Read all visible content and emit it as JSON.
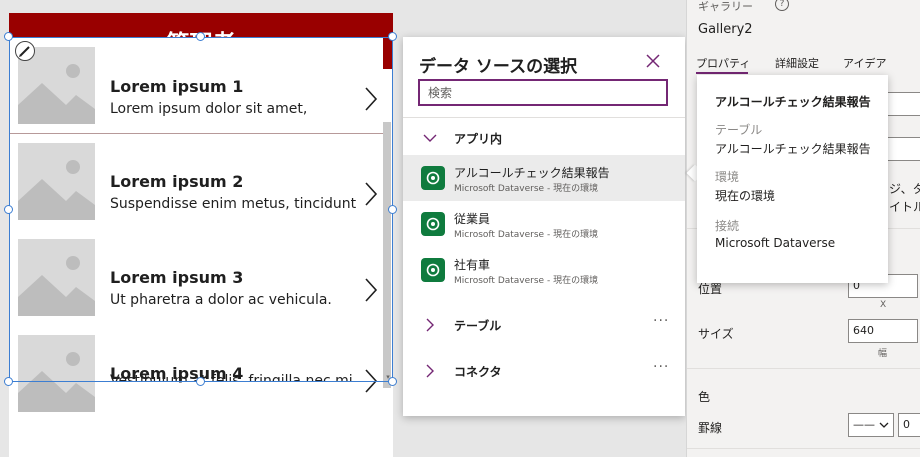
{
  "app": {
    "header_title": "管理者",
    "gallery_items": [
      {
        "title": "Lorem ipsum 1",
        "subtitle": "Lorem ipsum dolor sit amet,"
      },
      {
        "title": "Lorem ipsum 2",
        "subtitle": "Suspendisse enim metus, tincidunt"
      },
      {
        "title": "Lorem ipsum 3",
        "subtitle": "Ut pharetra a dolor ac vehicula."
      },
      {
        "title": "Lorem ipsum 4",
        "subtitle": "Vestibulum at felis, fringilla nec mi"
      }
    ],
    "header_color": "#990000"
  },
  "data_source_panel": {
    "title": "データ ソースの選択",
    "search_placeholder": "検索",
    "groups": {
      "in_app": "アプリ内",
      "tables": "テーブル",
      "connectors": "コネクタ",
      "more": "···"
    },
    "items": [
      {
        "name": "アルコールチェック結果報告",
        "sub": "Microsoft Dataverse - 現在の環境"
      },
      {
        "name": "従業員",
        "sub": "Microsoft Dataverse - 現在の環境"
      },
      {
        "name": "社有車",
        "sub": "Microsoft Dataverse - 現在の環境"
      }
    ],
    "icons": {
      "close": "close-icon",
      "source": "dataverse-icon"
    }
  },
  "tooltip": {
    "title": "アルコールチェック結果報告",
    "table_label": "テーブル",
    "table_value": "アルコールチェック結果報告",
    "env_label": "環境",
    "env_value": "現在の環境",
    "conn_label": "接続",
    "conn_value": "Microsoft Dataverse"
  },
  "properties": {
    "control_type": "ギャラリー",
    "help": "?",
    "control_name": "Gallery2",
    "tabs": [
      "プロパティ",
      "詳細設定",
      "アイデア"
    ],
    "peek_text_1": "ジ、タ",
    "peek_text_2": "イトル",
    "position_label": "位置",
    "position_x": "0",
    "x_caption": "X",
    "size_label": "サイズ",
    "size_width": "640",
    "width_caption": "幅",
    "color_label": "色",
    "border_label": "罫線",
    "border_style": "——",
    "border_width": "0",
    "accent_color": "#742774"
  }
}
